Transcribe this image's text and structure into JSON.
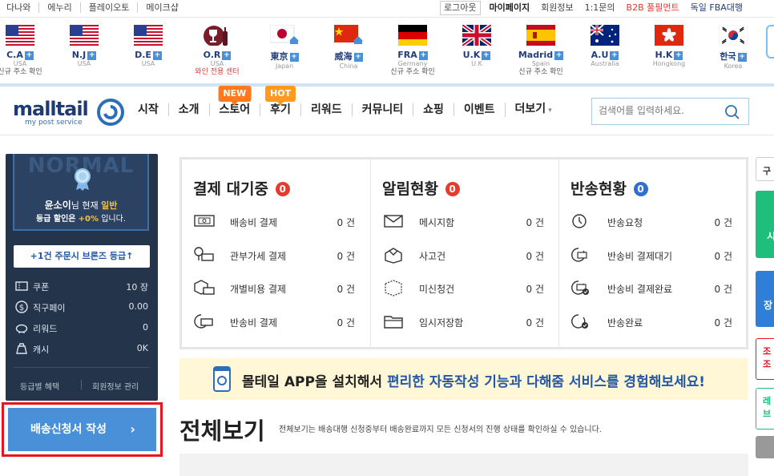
{
  "topbar": {
    "left_links": [
      "다나와",
      "에누리",
      "플레이오토",
      "메이크샵"
    ],
    "logout": "로그아웃",
    "mypage": "마이페이지",
    "member_info": "회원정보",
    "inquiry": "1:1문의",
    "b2b": "B2B 풀필먼트",
    "fba": "독일 FBA대행"
  },
  "flags": [
    {
      "name": "C.A",
      "sub": "USA",
      "note": "신규 주소 확인",
      "note_color": "dark"
    },
    {
      "name": "N.J",
      "sub": "USA",
      "note": "",
      "note_color": "dark"
    },
    {
      "name": "D.E",
      "sub": "USA",
      "note": "",
      "note_color": "dark"
    },
    {
      "name": "O.R",
      "sub": "USA",
      "note": "와인 전용 센터",
      "note_color": "red"
    },
    {
      "name": "東京",
      "sub": "Japan",
      "note": "",
      "note_color": "dark"
    },
    {
      "name": "威海",
      "sub": "China",
      "note": "",
      "note_color": "dark"
    },
    {
      "name": "FRA",
      "sub": "Germany",
      "note": "신규 주소 확인",
      "note_color": "dark"
    },
    {
      "name": "U.K",
      "sub": "U.K",
      "note": "",
      "note_color": "dark"
    },
    {
      "name": "Madrid",
      "sub": "Spain",
      "note": "신규 주소 확인",
      "note_color": "dark"
    },
    {
      "name": "A.U",
      "sub": "Australia",
      "note": "",
      "note_color": "dark"
    },
    {
      "name": "H.K",
      "sub": "Hongkong",
      "note": "",
      "note_color": "dark"
    },
    {
      "name": "한국",
      "sub": "Korea",
      "note": "",
      "note_color": "dark"
    }
  ],
  "nav": {
    "logo": "malltail",
    "logo_sub": "my post service",
    "menu": [
      {
        "label": "시작",
        "badge": ""
      },
      {
        "label": "소개",
        "badge": ""
      },
      {
        "label": "스토어",
        "badge": "NEW"
      },
      {
        "label": "후기",
        "badge": "HOT"
      },
      {
        "label": "리워드",
        "badge": ""
      },
      {
        "label": "커뮤니티",
        "badge": ""
      },
      {
        "label": "쇼핑",
        "badge": ""
      },
      {
        "label": "이벤트",
        "badge": ""
      },
      {
        "label": "더보기",
        "badge": ""
      }
    ],
    "search_placeholder": "검색어를 입력하세요."
  },
  "user": {
    "grade_watermark": "NORMAL",
    "name": "윤소이",
    "line1_mid": "님 현재",
    "grade": "일반",
    "line2_pre": "등급 할인은",
    "discount": "+0%",
    "line2_post": "입니다.",
    "upgrade_btn": "+1건 주문시 브론즈 등급↑",
    "items": [
      {
        "icon": "coupon-icon",
        "label": "쿠폰",
        "value": "10 장"
      },
      {
        "icon": "dollar-icon",
        "label": "직구페이",
        "value": "0.00"
      },
      {
        "icon": "piggy-icon",
        "label": "리워드",
        "value": "0"
      },
      {
        "icon": "cash-bag-icon",
        "label": "캐시",
        "value": "0K"
      }
    ],
    "link_benefit": "등급별 혜택",
    "link_member": "회원정보 관리"
  },
  "apply_button": "배송신청서 작성",
  "status": {
    "columns": [
      {
        "title": "결제 대기중",
        "badge": "0",
        "badge_color": "#e43b2d",
        "rows": [
          {
            "icon": "money-icon",
            "label": "배송비 결제",
            "count": "0 건"
          },
          {
            "icon": "bulb-money-icon",
            "label": "관부가세 결제",
            "count": "0 건"
          },
          {
            "icon": "box-money-icon",
            "label": "개별비용 결제",
            "count": "0 건"
          },
          {
            "icon": "return-money-icon",
            "label": "반송비 결제",
            "count": "0 건"
          }
        ]
      },
      {
        "title": "알림현황",
        "badge": "0",
        "badge_color": "#e43b2d",
        "rows": [
          {
            "icon": "mail-icon",
            "label": "메시지함",
            "count": "0 건"
          },
          {
            "icon": "broken-box-icon",
            "label": "사고건",
            "count": "0 건"
          },
          {
            "icon": "box-outline-icon",
            "label": "미신청건",
            "count": "0 건"
          },
          {
            "icon": "folder-icon",
            "label": "임시저장함",
            "count": "0 건"
          }
        ]
      },
      {
        "title": "반송현황",
        "badge": "0",
        "badge_color": "#2f6fcf",
        "rows": [
          {
            "icon": "return-request-icon",
            "label": "반송요청",
            "count": "0 건"
          },
          {
            "icon": "return-pay-wait-icon",
            "label": "반송비 결제대기",
            "count": "0 건"
          },
          {
            "icon": "return-pay-done-icon",
            "label": "반송비 결제완료",
            "count": "0 건"
          },
          {
            "icon": "return-done-icon",
            "label": "반송완료",
            "count": "0 건"
          }
        ]
      }
    ]
  },
  "app_banner": {
    "pre": "몰테일 APP을 설치해서 ",
    "highlight": "편리한 자동작성 기능과 다해줌 서비스를 경험해보세요!"
  },
  "section": {
    "title": "전체보기",
    "desc": "전체보기는 배송대행 신청중부터 배송완료까지 모든 신청서의 진행 상태를 확인하실 수 있습니다."
  },
  "right_tabs": [
    "구",
    "시",
    "장",
    "조\n조",
    "레\n브"
  ]
}
